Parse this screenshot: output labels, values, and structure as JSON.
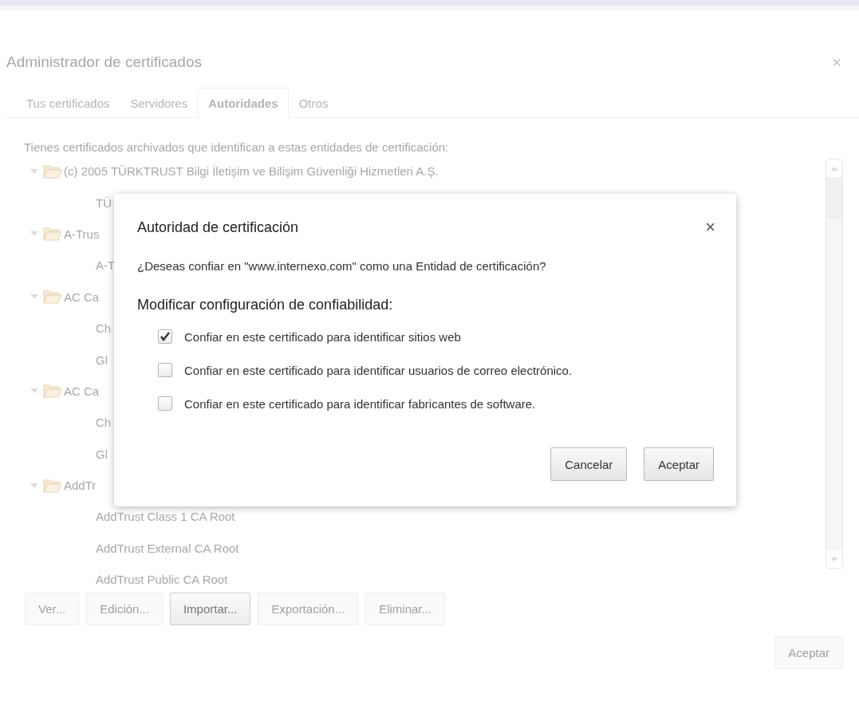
{
  "window": {
    "title": "Administrador de certificados",
    "close": "×"
  },
  "tabs": [
    {
      "label": "Tus certificados",
      "selected": false
    },
    {
      "label": "Servidores",
      "selected": false
    },
    {
      "label": "Autoridades",
      "selected": true
    },
    {
      "label": "Otros",
      "selected": false
    }
  ],
  "description": "Tienes certificados archivados que identifican a estas entidades de certificación:",
  "tree": [
    {
      "label": "(c) 2005 TÜRKTRUST Bilgi İletişim ve Bilişim Güvenliği Hizmetleri A.Ş.",
      "expanded": true,
      "children": [
        {
          "label": "TÜ"
        }
      ]
    },
    {
      "label": "A-Trus",
      "expanded": true,
      "children": [
        {
          "label": "A-T"
        }
      ]
    },
    {
      "label": "AC Ca",
      "expanded": true,
      "children": [
        {
          "label": "Ch"
        },
        {
          "label": "Gl"
        }
      ]
    },
    {
      "label": "AC Ca",
      "expanded": true,
      "children": [
        {
          "label": "Ch"
        },
        {
          "label": "Gl"
        }
      ]
    },
    {
      "label": "AddTr",
      "expanded": true,
      "children": [
        {
          "label": "AddTrust Class 1 CA Root"
        },
        {
          "label": "AddTrust External CA Root"
        },
        {
          "label": "AddTrust Public CA Root"
        }
      ]
    }
  ],
  "actions": [
    {
      "label": "Ver...",
      "disabled": true
    },
    {
      "label": "Edición...",
      "disabled": true
    },
    {
      "label": "Importar...",
      "disabled": false
    },
    {
      "label": "Exportación...",
      "disabled": true
    },
    {
      "label": "Eliminar...",
      "disabled": true
    }
  ],
  "footer_button": {
    "label": "Aceptar",
    "disabled": true
  },
  "dialog": {
    "title": "Autoridad de certificación",
    "close": "×",
    "question": "¿Deseas confiar en \"www.internexo.com\" como una Entidad de certificación?",
    "heading": "Modificar configuración de confiabilidad:",
    "options": [
      {
        "label": "Confiar en este certificado para identificar sitios web",
        "checked": true
      },
      {
        "label": "Confiar en este certificado para identificar usuarios de correo electrónico.",
        "checked": false
      },
      {
        "label": "Confiar en este certificado para identificar fabricantes de software.",
        "checked": false
      }
    ],
    "buttons": [
      {
        "label": "Cancelar"
      },
      {
        "label": "Aceptar"
      }
    ]
  }
}
